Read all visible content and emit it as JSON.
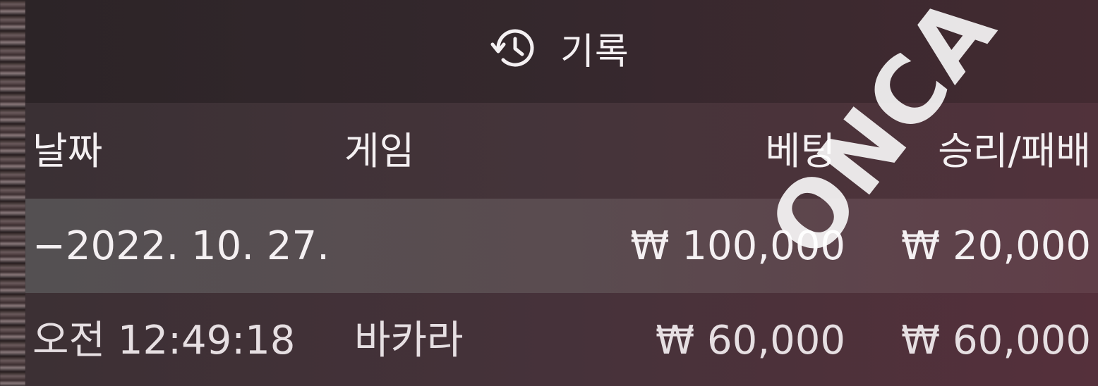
{
  "header": {
    "title": "기록",
    "icon": "history-icon"
  },
  "table": {
    "columns": [
      "날짜",
      "게임",
      "베팅",
      "승리/패배"
    ],
    "rows": [
      {
        "date": "−2022. 10. 27.",
        "game": "",
        "bet": "₩ 100,000",
        "result": "₩ 20,000"
      },
      {
        "date": "오전 12:49:18",
        "game": "바카라",
        "bet": "₩ 60,000",
        "result": "₩ 60,000"
      }
    ]
  },
  "watermark": "ONCA BEST",
  "colors": {
    "text": "#f4f0f2",
    "highlight_row": "#5a4c50",
    "accent": "#55303a"
  }
}
